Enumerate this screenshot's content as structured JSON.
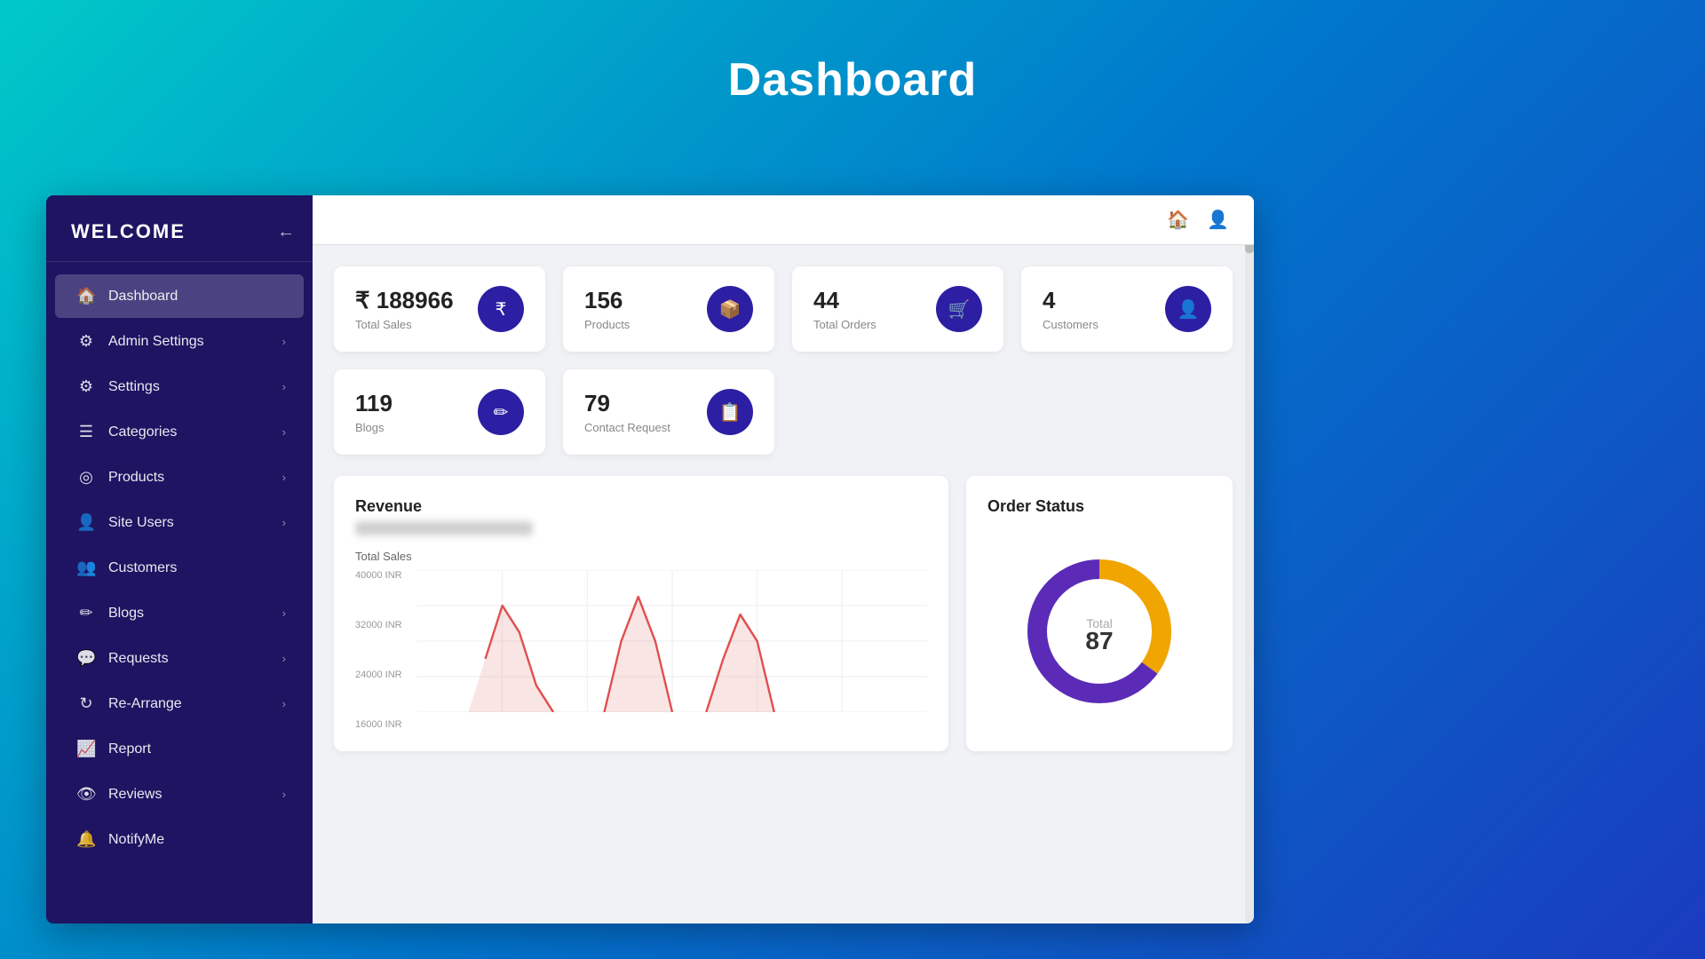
{
  "page": {
    "title": "Dashboard",
    "background": "linear-gradient(135deg, #00c9c8 0%, #0077cc 50%, #1a3bbf 100%)"
  },
  "sidebar": {
    "brand": "WELCOME",
    "back_icon": "←",
    "items": [
      {
        "id": "dashboard",
        "label": "Dashboard",
        "icon": "🏠",
        "active": true,
        "has_arrow": false
      },
      {
        "id": "admin-settings",
        "label": "Admin Settings",
        "icon": "⚙",
        "active": false,
        "has_arrow": true
      },
      {
        "id": "settings",
        "label": "Settings",
        "icon": "⚙",
        "active": false,
        "has_arrow": true
      },
      {
        "id": "categories",
        "label": "Categories",
        "icon": "☰",
        "active": false,
        "has_arrow": true
      },
      {
        "id": "products",
        "label": "Products",
        "icon": "◎",
        "active": false,
        "has_arrow": true
      },
      {
        "id": "site-users",
        "label": "Site Users",
        "icon": "👤",
        "active": false,
        "has_arrow": true
      },
      {
        "id": "customers",
        "label": "Customers",
        "icon": "👥",
        "active": false,
        "has_arrow": false
      },
      {
        "id": "blogs",
        "label": "Blogs",
        "icon": "✏",
        "active": false,
        "has_arrow": true
      },
      {
        "id": "requests",
        "label": "Requests",
        "icon": "💬",
        "active": false,
        "has_arrow": true
      },
      {
        "id": "re-arrange",
        "label": "Re-Arrange",
        "icon": "↻",
        "active": false,
        "has_arrow": true
      },
      {
        "id": "report",
        "label": "Report",
        "icon": "📈",
        "active": false,
        "has_arrow": false
      },
      {
        "id": "reviews",
        "label": "Reviews",
        "icon": "👁",
        "active": false,
        "has_arrow": true
      },
      {
        "id": "notifyme",
        "label": "NotifyMe",
        "icon": "🔔",
        "active": false,
        "has_arrow": false
      }
    ]
  },
  "topbar": {
    "home_icon": "🏠",
    "user_icon": "👤"
  },
  "stat_cards_row1": [
    {
      "id": "total-sales",
      "value": "₹ 188966",
      "label": "Total Sales",
      "icon": "₹",
      "icon_color": "#2d1fa3"
    },
    {
      "id": "products",
      "value": "156",
      "label": "Products",
      "icon": "📦",
      "icon_color": "#2d1fa3"
    },
    {
      "id": "total-orders",
      "value": "44",
      "label": "Total Orders",
      "icon": "🛒",
      "icon_color": "#2d1fa3"
    },
    {
      "id": "customers",
      "value": "4",
      "label": "Customers",
      "icon": "👤",
      "icon_color": "#2d1fa3"
    }
  ],
  "stat_cards_row2": [
    {
      "id": "blogs",
      "value": "119",
      "label": "Blogs",
      "icon": "✏",
      "icon_color": "#2d1fa3"
    },
    {
      "id": "contact-request",
      "value": "79",
      "label": "Contact Request",
      "icon": "📋",
      "icon_color": "#2d1fa3"
    }
  ],
  "revenue": {
    "title": "Revenue",
    "sub_label": "Total Sales",
    "y_axis": [
      "40000 INR",
      "32000 INR",
      "24000 INR",
      "16000 INR"
    ],
    "blur_bar_placeholder": "blurred value"
  },
  "order_status": {
    "title": "Order Status",
    "total_label": "Total",
    "total_value": "87",
    "donut": {
      "purple_percent": 65,
      "orange_percent": 35,
      "purple_color": "#5b2bb7",
      "orange_color": "#f0a500"
    }
  }
}
